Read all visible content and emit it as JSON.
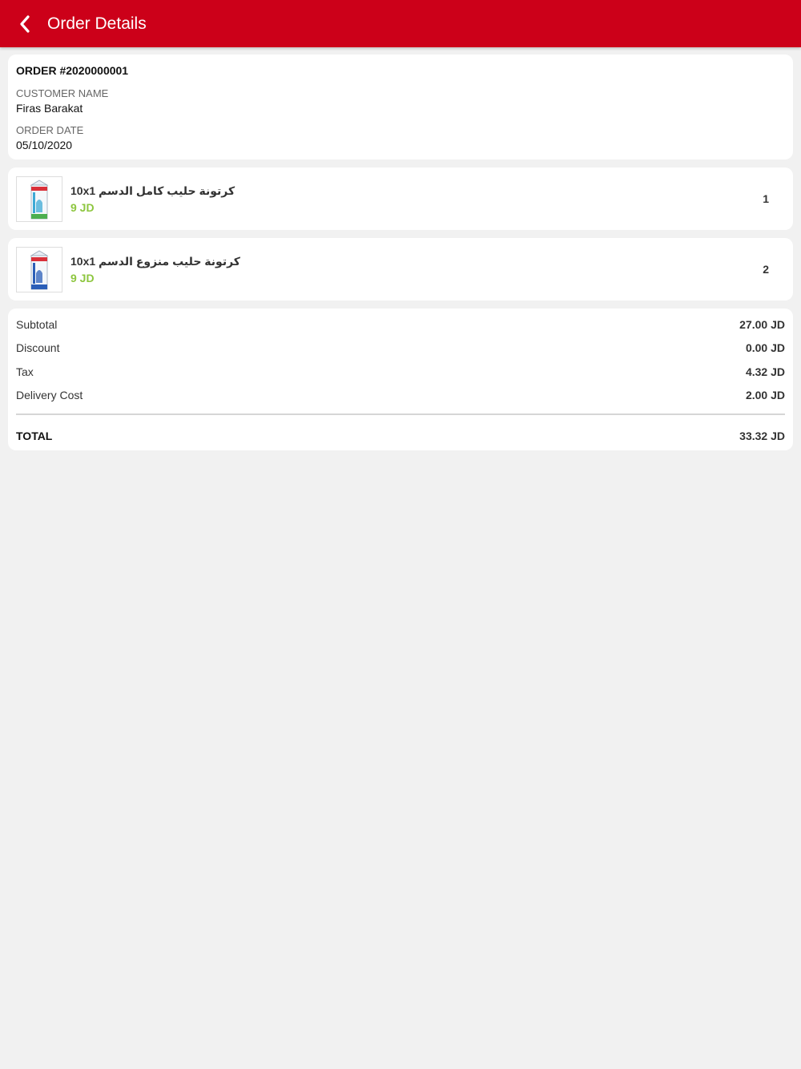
{
  "header": {
    "title": "Order Details",
    "back_icon": "chevron-left-icon",
    "background_color": "#cc0019"
  },
  "order": {
    "number": "ORDER #2020000001",
    "customer_label": "CUSTOMER NAME",
    "customer_name": "Firas Barakat",
    "date_label": "ORDER DATE",
    "date": "05/10/2020"
  },
  "items": [
    {
      "name": "كرتونة حليب كامل الدسم 10x1",
      "price": "9 JD",
      "quantity": "1",
      "thumbnail_icon": "milk-carton-icon"
    },
    {
      "name": "كرتونة حليب منزوع الدسم 10x1",
      "price": "9 JD",
      "quantity": "2",
      "thumbnail_icon": "milk-carton-icon"
    }
  ],
  "totals": {
    "subtotal_label": "Subtotal",
    "subtotal_value": "27.00 JD",
    "discount_label": "Discount",
    "discount_value": "0.00 JD",
    "tax_label": "Tax",
    "tax_value": "4.32 JD",
    "delivery_label": "Delivery Cost",
    "delivery_value": "2.00 JD",
    "total_label": "TOTAL",
    "total_value": "33.32 JD"
  },
  "colors": {
    "accent": "#cc0019",
    "price": "#8dc63f",
    "background": "#f1f1f1"
  }
}
